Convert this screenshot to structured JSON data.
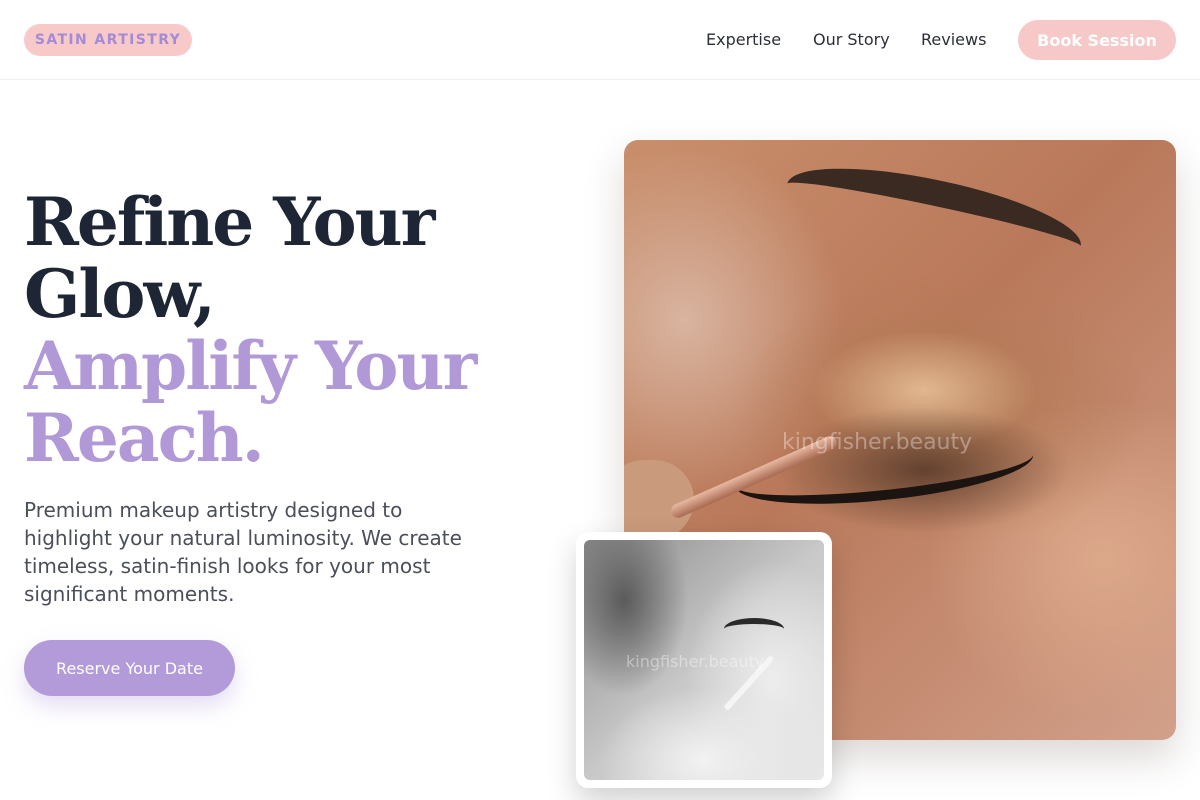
{
  "header": {
    "logo": "SATIN ARTISTRY",
    "nav": {
      "expertise": "Expertise",
      "our_story": "Our Story",
      "reviews": "Reviews"
    },
    "cta": "Book Session"
  },
  "hero": {
    "headline": {
      "line1": "Refine Your",
      "line2": "Glow,",
      "line3": "Amplify Your",
      "line4": "Reach."
    },
    "description": "Premium makeup artistry designed to highlight your natural luminosity. We create timeless, satin-finish looks for your most significant moments.",
    "cta": "Reserve Your Date"
  },
  "images": {
    "main_watermark": "kingfisher.beauty",
    "secondary_watermark": "kingfisher.beauty"
  },
  "colors": {
    "accent_pink": "#f7c8c8",
    "accent_lavender": "#b39ad9",
    "headline_dark": "#1e2636"
  }
}
